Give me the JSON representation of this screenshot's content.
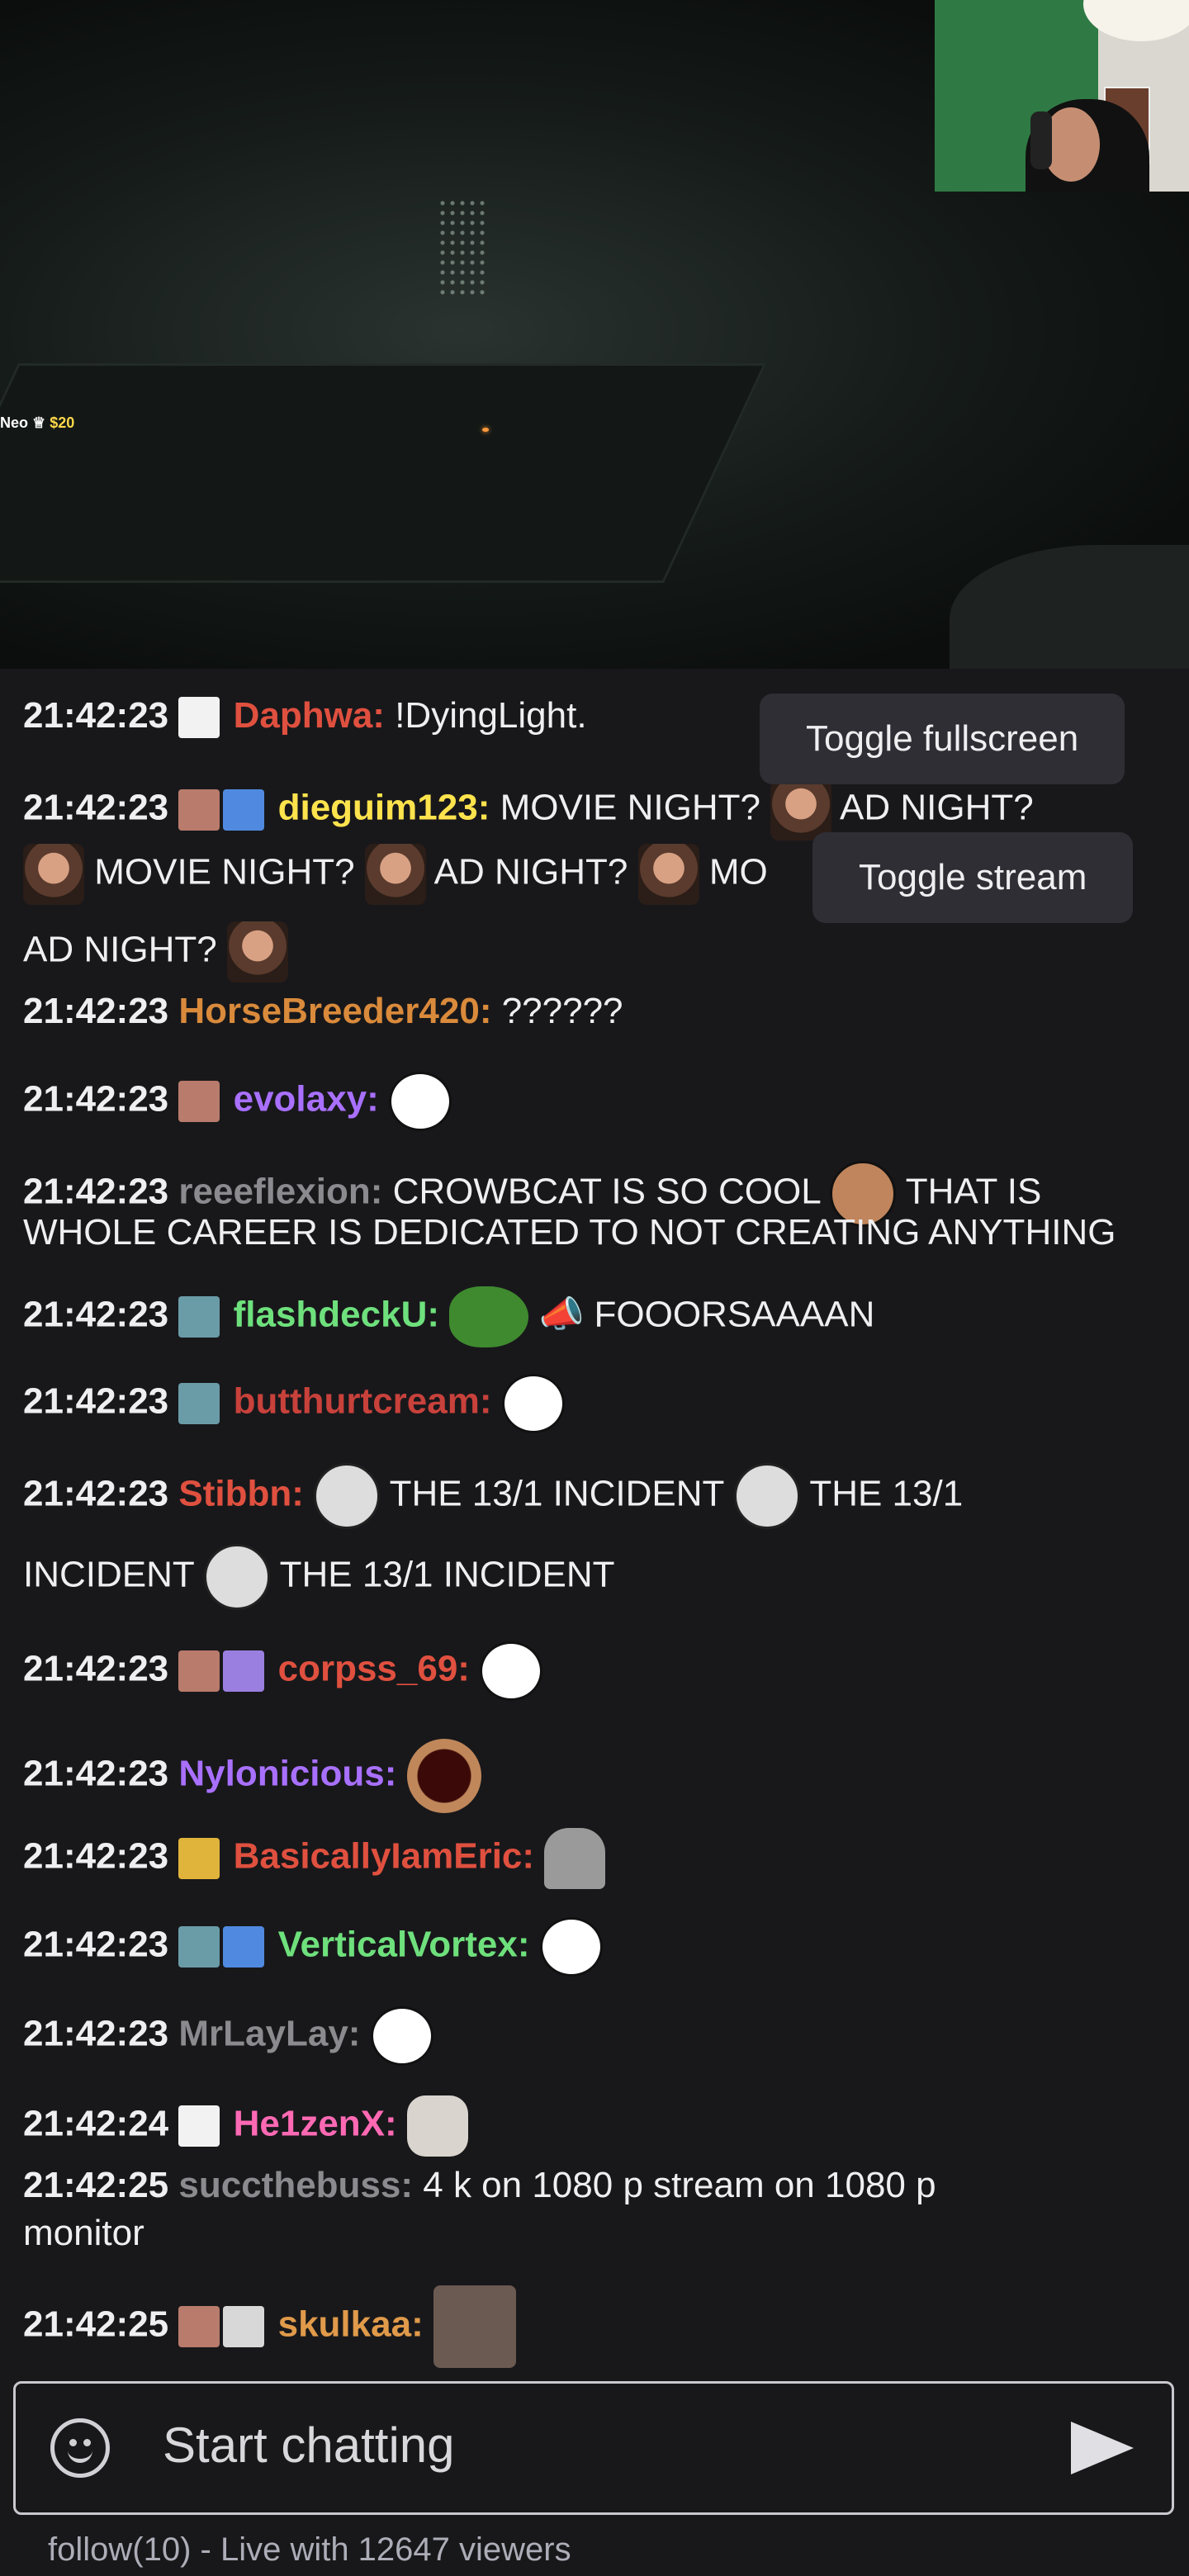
{
  "stream": {
    "donation_name": "Neo",
    "donation_amount": "$20"
  },
  "menu": {
    "toggle_fullscreen": "Toggle fullscreen",
    "toggle_stream": "Toggle stream"
  },
  "messages": [
    {
      "time": "21:42:23",
      "user": "Daphwa:",
      "user_color": "#e0503f",
      "text": "!DyingLight."
    },
    {
      "time": "21:42:23",
      "user": "dieguim123:",
      "user_color": "#ffe34d",
      "text1": "MOVIE NIGHT?",
      "text2": "AD NIGHT?",
      "text3": "MOVIE NIGHT?",
      "text4": "AD NIGHT?",
      "text5": "MO",
      "text6": "AD NIGHT?"
    },
    {
      "time": "21:42:23",
      "user": "HorseBreeder420:",
      "user_color": "#d98a3b",
      "text": "??????"
    },
    {
      "time": "21:42:23",
      "user": "evolaxy:",
      "user_color": "#a970ff",
      "text": ""
    },
    {
      "time": "21:42:23",
      "user": "reeeflexion:",
      "user_color": "#8a8a8f",
      "text1": "CROWBCAT IS SO COOL",
      "text2": "THAT IS",
      "text3": "WHOLE CAREER IS DEDICATED TO NOT CREATING ANYTHING"
    },
    {
      "time": "21:42:23",
      "user": "flashdeckU:",
      "user_color": "#6ee07c",
      "text": "📣 FOOORSAAAAN"
    },
    {
      "time": "21:42:23",
      "user": "butthurtcream:",
      "user_color": "#c8413b",
      "text": ""
    },
    {
      "time": "21:42:23",
      "user": "Stibbn:",
      "user_color": "#e0503f",
      "text1": "THE 13/1 INCIDENT",
      "text2": "THE 13/1",
      "text3": "INCIDENT",
      "text4": "THE 13/1 INCIDENT"
    },
    {
      "time": "21:42:23",
      "user": "corpss_69:",
      "user_color": "#e0503f",
      "text": ""
    },
    {
      "time": "21:42:23",
      "user": "Nylonicious:",
      "user_color": "#a970ff",
      "text": ""
    },
    {
      "time": "21:42:23",
      "user": "BasicallyIamEric:",
      "user_color": "#e0503f",
      "text": ""
    },
    {
      "time": "21:42:23",
      "user": "VerticalVortex:",
      "user_color": "#6ee07c",
      "text": ""
    },
    {
      "time": "21:42:23",
      "user": "MrLayLay:",
      "user_color": "#8a8a8f",
      "text": ""
    },
    {
      "time": "21:42:24",
      "user": "He1zenX:",
      "user_color": "#ff69b4",
      "text": ""
    },
    {
      "time": "21:42:25",
      "user": "succthebuss:",
      "user_color": "#8a8a8f",
      "text1": "4 k on 1080 p stream on 1080 p",
      "text2": "monitor"
    },
    {
      "time": "21:42:25",
      "user": "skulkaa:",
      "user_color": "#e09a4a",
      "text": ""
    }
  ],
  "input": {
    "placeholder": "Start chatting"
  },
  "status": "follow(10) - Live with 12647 viewers",
  "colors": {
    "background": "#18181b",
    "menu": "#2e2e34"
  }
}
